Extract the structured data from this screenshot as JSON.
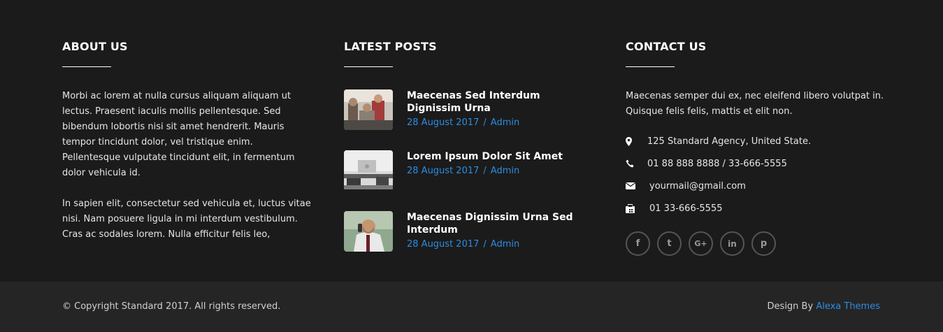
{
  "colors": {
    "background": "#1b1b1b",
    "bottom_bar": "#252525",
    "accent": "#2c8de0"
  },
  "about": {
    "heading": "ABOUT US",
    "paragraph1": "Morbi ac lorem at nulla cursus aliquam aliquam ut lectus. Praesent iaculis mollis pellentesque. Sed bibendum lobortis nisi sit amet hendrerit. Mauris tempor tincidunt dolor, vel tristique enim. Pellentesque vulputate tincidunt elit, in fermentum dolor vehicula id.",
    "paragraph2": "In sapien elit, consectetur sed vehicula et, luctus vitae nisi. Nam posuere ligula in mi interdum vestibulum. Cras ac sodales lorem. Nulla efficitur felis leo,"
  },
  "posts": {
    "heading": "LATEST POSTS",
    "items": [
      {
        "title": "Maecenas Sed Interdum Dignissim Urna",
        "date": "28 August 2017",
        "sep": "/",
        "author": "Admin"
      },
      {
        "title": "Lorem Ipsum Dolor Sit Amet",
        "date": "28 August 2017",
        "sep": "/",
        "author": "Admin"
      },
      {
        "title": "Maecenas Dignissim Urna Sed Interdum",
        "date": "28 August 2017",
        "sep": "/",
        "author": "Admin"
      }
    ]
  },
  "contact": {
    "heading": "CONTACT US",
    "intro": "Maecenas semper dui ex, nec eleifend libero volutpat in. Quisque felis felis, mattis et elit non.",
    "address": "125 Standard Agency, United State.",
    "phone": "01 88 888 8888 / 33-666-5555",
    "email": "yourmail@gmail.com",
    "fax": "01 33-666-5555",
    "icons": {
      "address": "map-marker-icon",
      "phone": "phone-icon",
      "email": "envelope-icon",
      "fax": "fax-icon"
    },
    "socials": [
      {
        "name": "facebook",
        "glyph": "f"
      },
      {
        "name": "twitter",
        "glyph": "t"
      },
      {
        "name": "google-plus",
        "glyph": "G+"
      },
      {
        "name": "linkedin",
        "glyph": "in"
      },
      {
        "name": "pinterest",
        "glyph": "p"
      }
    ]
  },
  "footer": {
    "copyright": "© Copyright Standard 2017. All rights reserved.",
    "credit_prefix": "Design By",
    "credit_link": "Alexa Themes"
  }
}
